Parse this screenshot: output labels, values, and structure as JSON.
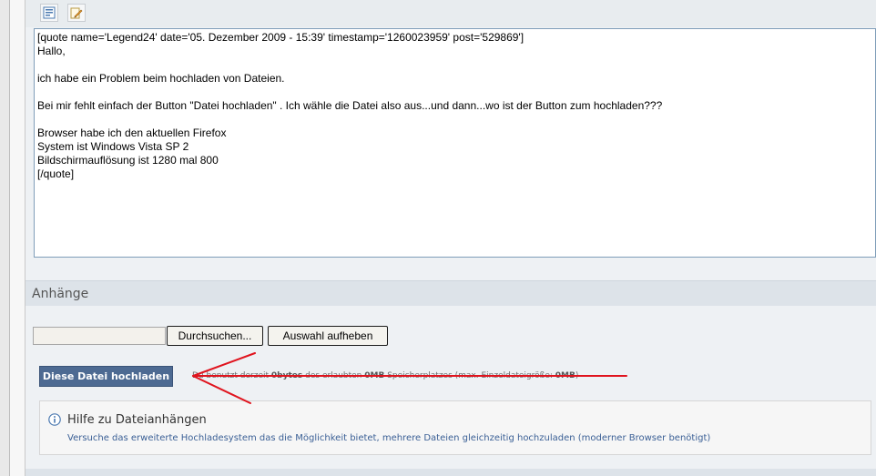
{
  "toolbar": {
    "icons": [
      "source-view-icon",
      "edit-icon"
    ]
  },
  "editor": {
    "lines": [
      "[quote name='Legend24' date='05. Dezember 2009 - 15:39' timestamp='1260023959' post='529869']",
      "Hallo,",
      "",
      "ich habe ein Problem beim hochladen von Dateien.",
      "",
      "Bei mir fehlt einfach der Button \"Datei hochladen\" . Ich wähle die Datei also aus...und dann...wo ist der Button zum hochladen???",
      "",
      "Browser habe ich den aktuellen Firefox",
      "System ist Windows Vista SP 2",
      "Bildschirmauflösung ist 1280 mal 800",
      "[/quote]"
    ]
  },
  "attachments": {
    "title": "Anhänge",
    "browse_label": "Durchsuchen...",
    "clear_label": "Auswahl aufheben",
    "upload_label": "Diese Datei hochladen",
    "quota_prefix": "Du benutzt derzeit",
    "quota_used": "0bytes",
    "quota_mid": "des erlaubten",
    "quota_total": "0MB",
    "quota_suffix": "Speicherplatzes (max. Einzeldateigröße:",
    "quota_max": "0MB",
    "quota_close": ")"
  },
  "help": {
    "title": "Hilfe zu Dateianhängen",
    "text": "Versuche das erweiterte Hochladesystem das die Möglichkeit bietet, mehrere Dateien gleichzeitig hochzuladen (moderner Browser benötigt)"
  },
  "colors": {
    "annotation_arrow": "#e0141e",
    "upload_button": "#4d6a92",
    "help_link": "#3a5f95"
  }
}
